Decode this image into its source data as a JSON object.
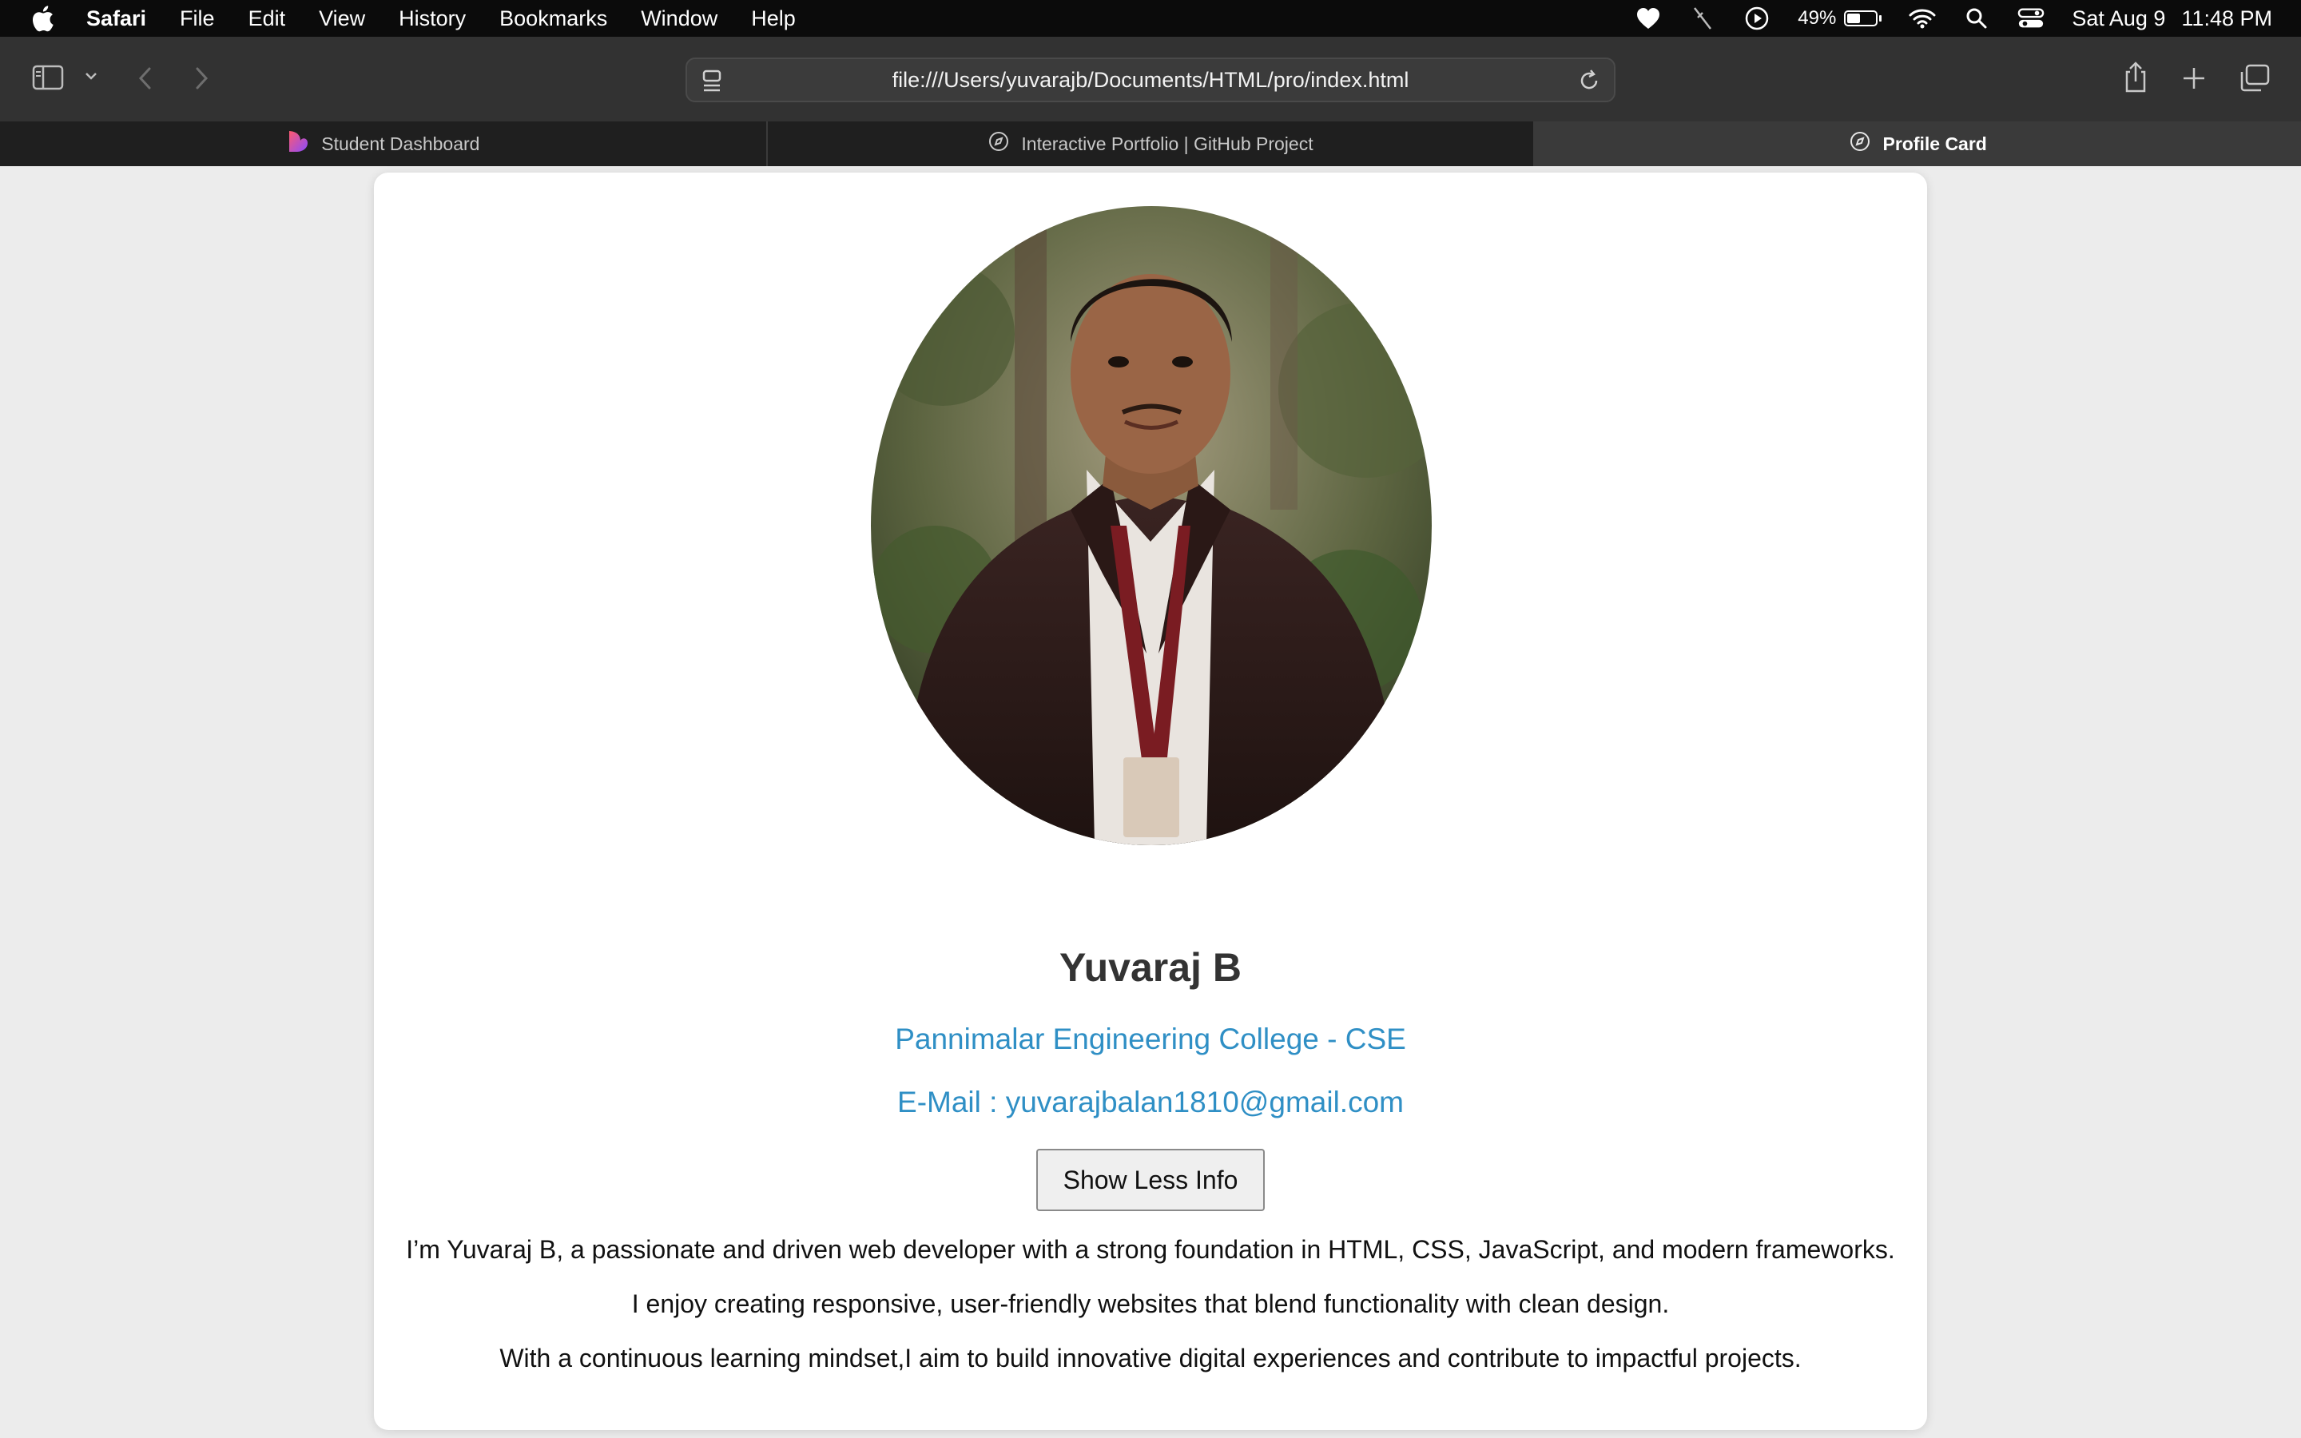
{
  "menubar": {
    "app_name": "Safari",
    "items": [
      "File",
      "Edit",
      "View",
      "History",
      "Bookmarks",
      "Window",
      "Help"
    ],
    "battery_percent": "49%",
    "date": "Sat Aug 9",
    "time": "11:48 PM"
  },
  "toolbar": {
    "url": "file:///Users/yuvarajb/Documents/HTML/pro/index.html"
  },
  "tabs": [
    {
      "label": "Student Dashboard",
      "icon": "heart-app-icon",
      "active": false
    },
    {
      "label": "Interactive Portfolio | GitHub Project",
      "icon": "compass-icon",
      "active": false
    },
    {
      "label": "Profile Card",
      "icon": "compass-icon",
      "active": true
    }
  ],
  "profile": {
    "name": "Yuvaraj B",
    "college": "Pannimalar Engineering College - CSE",
    "email": "E-Mail : yuvarajbalan1810@gmail.com",
    "toggle_label": "Show Less Info",
    "bio": [
      "I’m Yuvaraj B, a passionate and driven web developer with a strong foundation in HTML, CSS, JavaScript, and modern frameworks.",
      "I enjoy creating responsive, user-friendly websites that blend functionality with clean design.",
      "With a continuous learning mindset,I aim to build innovative digital experiences and contribute to impactful projects."
    ]
  },
  "colors": {
    "accent": "#2f8fc5",
    "name_text": "#333333",
    "page_bg": "#ececec"
  }
}
